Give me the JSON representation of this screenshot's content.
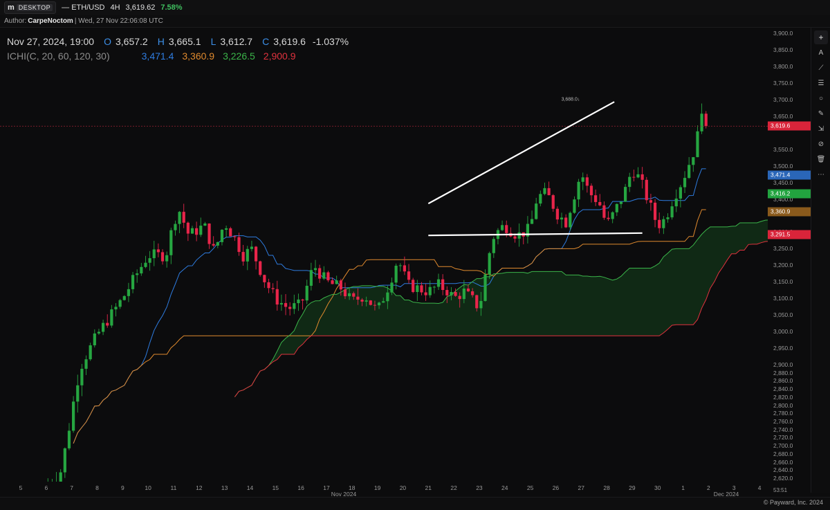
{
  "header": {
    "logo_text": "DESKTOP",
    "symbol": "— ETH/USD",
    "timeframe": "4H",
    "last_price": "3,619.62",
    "change": "7.58%",
    "change_color": "#3fbf5f"
  },
  "author": {
    "prefix": "Author:",
    "name": "CarpeNoctom",
    "timestamp": "| Wed, 27 Nov 22:06:08 UTC"
  },
  "ohlc": {
    "datetime": "Nov 27, 2024, 19:00",
    "o_label": "O",
    "o": "3,657.2",
    "h_label": "H",
    "h": "3,665.1",
    "l_label": "L",
    "l": "3,612.7",
    "c_label": "C",
    "c": "3,619.6",
    "change": "-1.037%"
  },
  "indicator": {
    "name": "ICHI(C, 20, 60, 120, 30)",
    "v1": "3,471.4",
    "v1_color": "#2e7ce0",
    "v2": "3,360.9",
    "v2_color": "#e08a2e",
    "v3": "3,226.5",
    "v3_color": "#3bb54a",
    "v4": "2,900.9",
    "v4_color": "#e0323e"
  },
  "price_axis": {
    "ticks_upper": [
      "3,900.0",
      "3,850.0",
      "3,800.0",
      "3,750.0",
      "3,700.0",
      "3,650.0",
      "3,550.0",
      "3,500.0",
      "3,450.0",
      "3,400.0",
      "3,300.0",
      "3,250.0",
      "3,200.0",
      "3,150.0",
      "3,100.0",
      "3,050.0",
      "3,000.0",
      "2,950.0",
      "2,900.0"
    ],
    "ticks_lower": [
      "2,880.0",
      "2,860.0",
      "2,840.0",
      "2,820.0",
      "2,800.0",
      "2,780.0",
      "2,760.0",
      "2,740.0",
      "2,720.0",
      "2,700.0",
      "2,680.0",
      "2,660.0",
      "2,640.0",
      "2,620.0"
    ],
    "tags": [
      {
        "label": "3,619.6",
        "color": "#d9243a",
        "value": 3619.6
      },
      {
        "label": "3,471.4",
        "color": "#2a66b8",
        "value": 3471.4
      },
      {
        "label": "3,416.2",
        "color": "#22a33f",
        "value": 3416.2
      },
      {
        "label": "3,360.9",
        "color": "#8a5a1c",
        "value": 3360.9
      },
      {
        "label": "3,291.5",
        "color": "#d9243a",
        "value": 3291.5
      }
    ],
    "countdown": "53:51"
  },
  "time_axis": {
    "days": [
      "5",
      "6",
      "7",
      "8",
      "9",
      "10",
      "11",
      "12",
      "13",
      "14",
      "15",
      "16",
      "17",
      "18",
      "19",
      "20",
      "21",
      "22",
      "23",
      "24",
      "25",
      "26",
      "27",
      "28",
      "29",
      "30",
      "1",
      "2",
      "3",
      "4"
    ],
    "month_nov": "Nov 2024",
    "month_dec": "Dec 2024"
  },
  "annotation": {
    "high_label": "3,688.0↓"
  },
  "footer": {
    "copyright": "© Payward, Inc. 2024"
  },
  "toolbar": {
    "icons": [
      "plus-icon",
      "text-icon",
      "line-icon",
      "menu-icon",
      "circle-icon",
      "brush-icon",
      "measure-icon",
      "hide-icon",
      "trash-icon",
      "settings-icon"
    ]
  },
  "chart_data": {
    "type": "candlestick",
    "title": "ETH/USD 4H",
    "ylim": [
      2610,
      3910
    ],
    "last_close": 3619.6,
    "pattern_upper_line": [
      [
        3386,
        21.0
      ],
      [
        3693,
        28.3
      ]
    ],
    "pattern_lower_line": [
      [
        3290,
        21.0
      ],
      [
        3297,
        29.4
      ]
    ],
    "colors": {
      "up": "#26a641",
      "down": "#e8254a",
      "tenkan": "#2e7ce0",
      "kijun": "#e08a2e",
      "span_a": "#3bb54a",
      "span_b": "#e0323e"
    }
  }
}
